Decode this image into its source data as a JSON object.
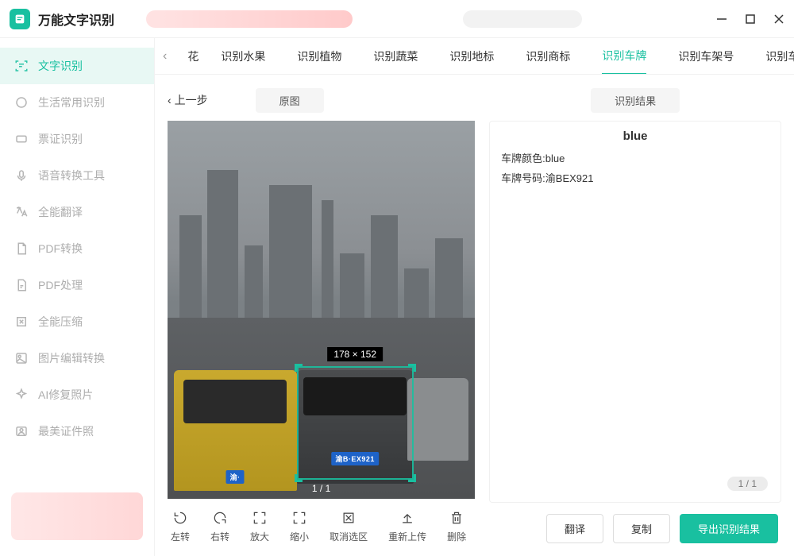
{
  "app": {
    "title": "万能文字识别"
  },
  "sidebar": {
    "items": [
      {
        "label": "文字识别",
        "icon": "text-scan-icon",
        "active": true
      },
      {
        "label": "生活常用识别",
        "icon": "daily-icon"
      },
      {
        "label": "票证识别",
        "icon": "ticket-icon"
      },
      {
        "label": "语音转换工具",
        "icon": "audio-icon"
      },
      {
        "label": "全能翻译",
        "icon": "translate-icon"
      },
      {
        "label": "PDF转换",
        "icon": "pdf-convert-icon"
      },
      {
        "label": "PDF处理",
        "icon": "pdf-process-icon"
      },
      {
        "label": "全能压缩",
        "icon": "compress-icon"
      },
      {
        "label": "图片编辑转换",
        "icon": "image-edit-icon"
      },
      {
        "label": "AI修复照片",
        "icon": "ai-restore-icon"
      },
      {
        "label": "最美证件照",
        "icon": "id-photo-icon"
      }
    ]
  },
  "tabs": {
    "partial_first": "花",
    "items": [
      "识别水果",
      "识别植物",
      "识别蔬菜",
      "识别地标",
      "识别商标",
      "识别车牌",
      "识别车架号",
      "识别车型"
    ],
    "active_index": 5
  },
  "left": {
    "back": "上一步",
    "pill": "原图",
    "selection_label": "178 × 152",
    "image_counter": "1 / 1",
    "plate_text": "渝B·EX921",
    "plate_text2": "渝·"
  },
  "right": {
    "pill": "识别结果",
    "title": "blue",
    "lines": [
      "车牌颜色:blue",
      "车牌号码:渝BEX921"
    ],
    "counter": "1 / 1"
  },
  "tools": [
    "左转",
    "右转",
    "放大",
    "缩小",
    "取消选区",
    "重新上传",
    "删除"
  ],
  "actions": {
    "translate": "翻译",
    "copy": "复制",
    "export": "导出识别结果"
  }
}
